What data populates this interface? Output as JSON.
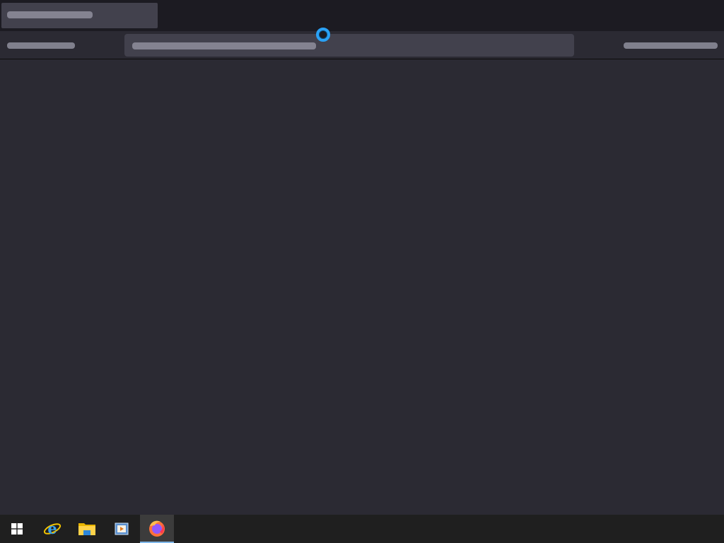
{
  "browser": {
    "tabs": [
      {
        "title": ""
      }
    ],
    "url": "",
    "loading": true
  },
  "taskbar": {
    "items": [
      {
        "icon": "windows-start-icon"
      },
      {
        "icon": "internet-explorer-icon"
      },
      {
        "icon": "file-explorer-icon"
      },
      {
        "icon": "media-player-icon"
      },
      {
        "icon": "firefox-icon",
        "active": true
      }
    ]
  },
  "colors": {
    "tabstrip": "#1c1b22",
    "toolbar": "#2b2a33",
    "urlbar": "#42414d",
    "spinner": "#2aa1f5",
    "taskbar": "#1f1f1f"
  }
}
